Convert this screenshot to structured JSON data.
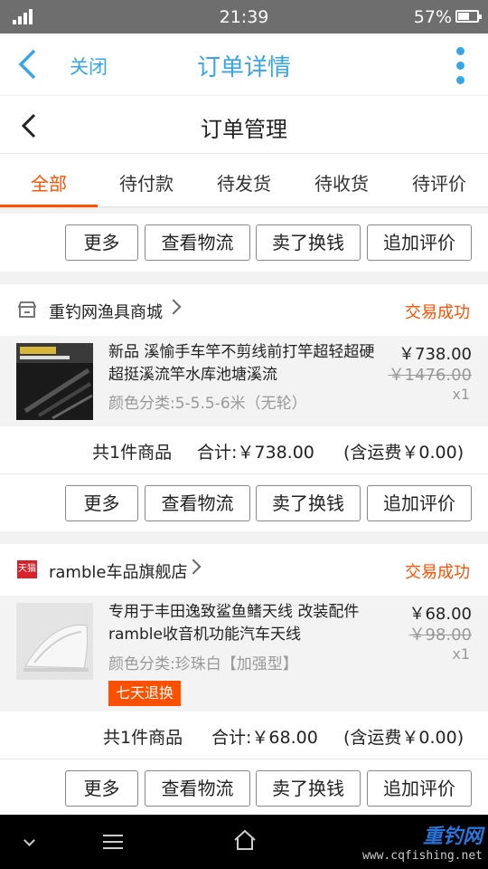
{
  "status_bar": {
    "time": "21:39",
    "battery": "57%"
  },
  "top_nav": {
    "close_label": "关闭",
    "title": "订单详情"
  },
  "page_header": {
    "title": "订单管理"
  },
  "tabs": [
    {
      "label": "全部",
      "active": true
    },
    {
      "label": "待付款"
    },
    {
      "label": "待发货"
    },
    {
      "label": "待收货"
    },
    {
      "label": "待评价"
    }
  ],
  "actions": {
    "more": "更多",
    "logistics": "查看物流",
    "sell": "卖了换钱",
    "review": "追加评价"
  },
  "orders": [
    {
      "shop": "重钓网渔具商城",
      "status": "交易成功",
      "item": {
        "name": "新品 溪愉手车竿不剪线前打竿超轻超硬超挺溪流竿水库池塘溪流",
        "spec": "颜色分类:5-5.5-6米（无轮）",
        "price": "￥738.00",
        "orig_price": "￥1476.00",
        "qty": "x1"
      },
      "summary": {
        "count": "共1件商品",
        "total": "合计:￥738.00",
        "shipping": "(含运费￥0.00)"
      }
    },
    {
      "shop": "ramble车品旗舰店",
      "shop_badge": "天猫",
      "status": "交易成功",
      "item": {
        "name": "专用于丰田逸致鲨鱼鳍天线 改装配件ramble收音机功能汽车天线",
        "spec": "颜色分类:珍珠白【加强型】",
        "price": "￥68.00",
        "orig_price": "￥98.00",
        "qty": "x1",
        "tag": "七天退换"
      },
      "summary": {
        "count": "共1件商品",
        "total": "合计:￥68.00",
        "shipping": "(含运费￥0.00)"
      }
    }
  ],
  "watermark": {
    "brand": "重钓网",
    "url": "www.cqfishing.net"
  }
}
